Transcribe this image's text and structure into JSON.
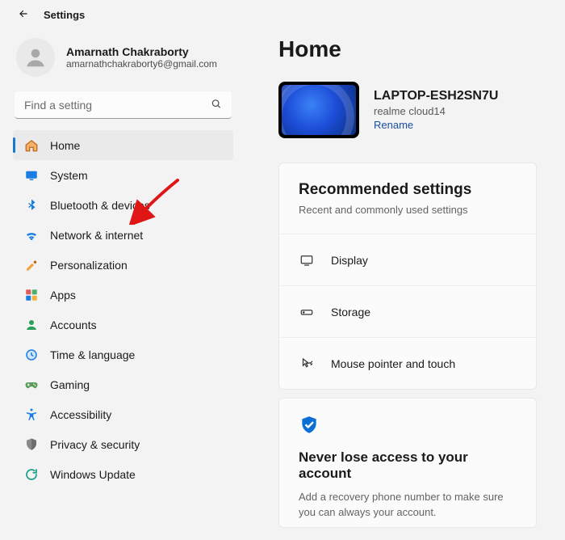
{
  "titlebar": {
    "title": "Settings"
  },
  "profile": {
    "name": "Amarnath Chakraborty",
    "email": "amarnathchakraborty6@gmail.com"
  },
  "search": {
    "placeholder": "Find a setting"
  },
  "nav": [
    {
      "key": "home",
      "label": "Home",
      "selected": true
    },
    {
      "key": "system",
      "label": "System"
    },
    {
      "key": "bluetooth",
      "label": "Bluetooth & devices"
    },
    {
      "key": "network",
      "label": "Network & internet"
    },
    {
      "key": "personalization",
      "label": "Personalization"
    },
    {
      "key": "apps",
      "label": "Apps"
    },
    {
      "key": "accounts",
      "label": "Accounts"
    },
    {
      "key": "time",
      "label": "Time & language"
    },
    {
      "key": "gaming",
      "label": "Gaming"
    },
    {
      "key": "accessibility",
      "label": "Accessibility"
    },
    {
      "key": "privacy",
      "label": "Privacy & security"
    },
    {
      "key": "update",
      "label": "Windows Update"
    }
  ],
  "main": {
    "heading": "Home",
    "device": {
      "name": "LAPTOP-ESH2SN7U",
      "model": "realme cloud14",
      "rename": "Rename"
    },
    "recommended": {
      "title": "Recommended settings",
      "subtitle": "Recent and commonly used settings",
      "rows": [
        {
          "key": "display",
          "label": "Display"
        },
        {
          "key": "storage",
          "label": "Storage"
        },
        {
          "key": "mouse",
          "label": "Mouse pointer and touch"
        }
      ]
    },
    "account_card": {
      "title": "Never lose access to your account",
      "text": "Add a recovery phone number to make sure you can always your account."
    }
  },
  "annotation": {
    "arrow_target": "bluetooth"
  }
}
